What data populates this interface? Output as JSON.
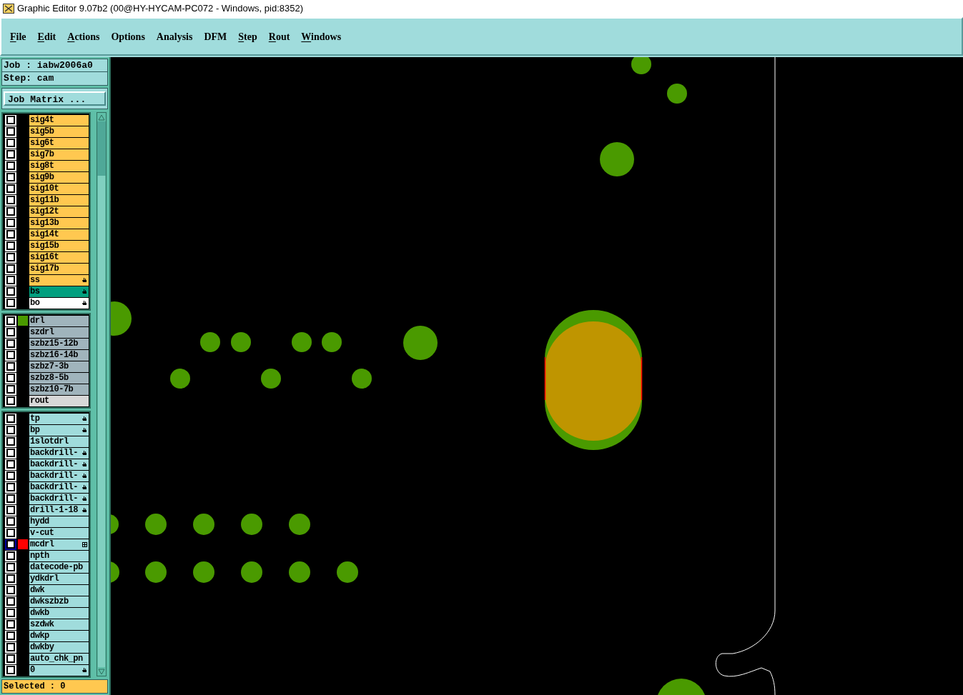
{
  "window": {
    "title": "Graphic Editor 9.07b2 (00@HY-HYCAM-PC072 - Windows, pid:8352)"
  },
  "menu": [
    {
      "label": "File",
      "mnemonic": true
    },
    {
      "label": "Edit",
      "mnemonic": true
    },
    {
      "label": "Actions",
      "mnemonic": true
    },
    {
      "label": "Options",
      "mnemonic": false
    },
    {
      "label": "Analysis",
      "mnemonic": false
    },
    {
      "label": "DFM",
      "mnemonic": false
    },
    {
      "label": "Step",
      "mnemonic": true
    },
    {
      "label": "Rout",
      "mnemonic": true
    },
    {
      "label": "Windows",
      "mnemonic": true
    }
  ],
  "job": "Job : iabw2006a0",
  "step": "Step: cam",
  "job_matrix_button": "Job Matrix ...",
  "layer_groups": [
    {
      "layers": [
        {
          "name": "sig4t",
          "kind": "board",
          "selected": false,
          "checked": false,
          "focused": false,
          "hand_icon": false,
          "grid_icon": false
        },
        {
          "name": "sig5b",
          "kind": "board",
          "selected": false,
          "checked": false,
          "focused": false,
          "hand_icon": false,
          "grid_icon": false
        },
        {
          "name": "sig6t",
          "kind": "board",
          "selected": false,
          "checked": false,
          "focused": false,
          "hand_icon": false,
          "grid_icon": false
        },
        {
          "name": "sig7b",
          "kind": "board",
          "selected": false,
          "checked": false,
          "focused": false,
          "hand_icon": false,
          "grid_icon": false
        },
        {
          "name": "sig8t",
          "kind": "board",
          "selected": false,
          "checked": false,
          "focused": false,
          "hand_icon": false,
          "grid_icon": false
        },
        {
          "name": "sig9b",
          "kind": "board",
          "selected": false,
          "checked": false,
          "focused": false,
          "hand_icon": false,
          "grid_icon": false
        },
        {
          "name": "sig10t",
          "kind": "board",
          "selected": false,
          "checked": false,
          "focused": false,
          "hand_icon": false,
          "grid_icon": false
        },
        {
          "name": "sig11b",
          "kind": "board",
          "selected": false,
          "checked": false,
          "focused": false,
          "hand_icon": false,
          "grid_icon": false
        },
        {
          "name": "sig12t",
          "kind": "board",
          "selected": false,
          "checked": false,
          "focused": false,
          "hand_icon": false,
          "grid_icon": false
        },
        {
          "name": "sig13b",
          "kind": "board",
          "selected": false,
          "checked": false,
          "focused": false,
          "hand_icon": false,
          "grid_icon": false
        },
        {
          "name": "sig14t",
          "kind": "board",
          "selected": false,
          "checked": false,
          "focused": false,
          "hand_icon": false,
          "grid_icon": false
        },
        {
          "name": "sig15b",
          "kind": "board",
          "selected": false,
          "checked": false,
          "focused": false,
          "hand_icon": false,
          "grid_icon": false
        },
        {
          "name": "sig16t",
          "kind": "board",
          "selected": false,
          "checked": false,
          "focused": false,
          "hand_icon": false,
          "grid_icon": false
        },
        {
          "name": "sig17b",
          "kind": "board",
          "selected": false,
          "checked": false,
          "focused": false,
          "hand_icon": false,
          "grid_icon": false
        },
        {
          "name": "ss",
          "kind": "board",
          "selected": false,
          "checked": false,
          "focused": false,
          "hand_icon": true,
          "grid_icon": false
        },
        {
          "name": "bs",
          "kind": "board",
          "selected": true,
          "checked": false,
          "focused": false,
          "hand_icon": true,
          "grid_icon": false
        },
        {
          "name": "bo",
          "kind": "outline",
          "selected": false,
          "checked": false,
          "focused": false,
          "hand_icon": true,
          "grid_icon": false
        }
      ]
    },
    {
      "layers": [
        {
          "name": "drl",
          "kind": "drill",
          "selected": false,
          "checked": false,
          "focused": false,
          "hand_icon": false,
          "grid_icon": false,
          "color": "#4a9a00"
        },
        {
          "name": "szdrl",
          "kind": "drill",
          "selected": false,
          "checked": false,
          "focused": false,
          "hand_icon": false,
          "grid_icon": false
        },
        {
          "name": "szbz15-12b",
          "kind": "drill",
          "selected": false,
          "checked": false,
          "focused": false,
          "hand_icon": false,
          "grid_icon": false
        },
        {
          "name": "szbz16-14b",
          "kind": "drill",
          "selected": false,
          "checked": false,
          "focused": false,
          "hand_icon": false,
          "grid_icon": false
        },
        {
          "name": "szbz7-3b",
          "kind": "drill",
          "selected": false,
          "checked": false,
          "focused": false,
          "hand_icon": false,
          "grid_icon": false
        },
        {
          "name": "szbz8-5b",
          "kind": "drill",
          "selected": false,
          "checked": false,
          "focused": false,
          "hand_icon": false,
          "grid_icon": false
        },
        {
          "name": "szbz10-7b",
          "kind": "drill",
          "selected": false,
          "checked": false,
          "focused": false,
          "hand_icon": false,
          "grid_icon": false
        },
        {
          "name": "rout",
          "kind": "rout",
          "selected": false,
          "checked": false,
          "focused": false,
          "hand_icon": false,
          "grid_icon": false
        }
      ]
    },
    {
      "layers": [
        {
          "name": "tp",
          "kind": "misc",
          "selected": false,
          "checked": false,
          "focused": false,
          "hand_icon": true,
          "grid_icon": false
        },
        {
          "name": "bp",
          "kind": "misc",
          "selected": false,
          "checked": false,
          "focused": false,
          "hand_icon": true,
          "grid_icon": false
        },
        {
          "name": "1slotdrl",
          "kind": "misc",
          "selected": false,
          "checked": false,
          "focused": false,
          "hand_icon": false,
          "grid_icon": false
        },
        {
          "name": "backdrill-",
          "kind": "misc",
          "selected": false,
          "checked": false,
          "focused": false,
          "hand_icon": true,
          "grid_icon": false
        },
        {
          "name": "backdrill-",
          "kind": "misc",
          "selected": false,
          "checked": false,
          "focused": false,
          "hand_icon": true,
          "grid_icon": false
        },
        {
          "name": "backdrill-",
          "kind": "misc",
          "selected": false,
          "checked": false,
          "focused": false,
          "hand_icon": true,
          "grid_icon": false
        },
        {
          "name": "backdrill-",
          "kind": "misc",
          "selected": false,
          "checked": false,
          "focused": false,
          "hand_icon": true,
          "grid_icon": false
        },
        {
          "name": "backdrill-",
          "kind": "misc",
          "selected": false,
          "checked": false,
          "focused": false,
          "hand_icon": true,
          "grid_icon": false
        },
        {
          "name": "drill-1-18",
          "kind": "misc",
          "selected": false,
          "checked": false,
          "focused": false,
          "hand_icon": true,
          "grid_icon": false
        },
        {
          "name": "hydd",
          "kind": "misc",
          "selected": false,
          "checked": false,
          "focused": false,
          "hand_icon": false,
          "grid_icon": false
        },
        {
          "name": "v-cut",
          "kind": "misc",
          "selected": false,
          "checked": false,
          "focused": false,
          "hand_icon": false,
          "grid_icon": false
        },
        {
          "name": "mcdrl",
          "kind": "misc",
          "selected": false,
          "checked": false,
          "focused": true,
          "hand_icon": false,
          "grid_icon": true,
          "color": "#ff0000"
        },
        {
          "name": "npth",
          "kind": "misc",
          "selected": false,
          "checked": false,
          "focused": false,
          "hand_icon": false,
          "grid_icon": false
        },
        {
          "name": "datecode-pb",
          "kind": "misc",
          "selected": false,
          "checked": false,
          "focused": false,
          "hand_icon": false,
          "grid_icon": false
        },
        {
          "name": "ydkdrl",
          "kind": "misc",
          "selected": false,
          "checked": false,
          "focused": false,
          "hand_icon": false,
          "grid_icon": false
        },
        {
          "name": "dwk",
          "kind": "misc",
          "selected": false,
          "checked": false,
          "focused": false,
          "hand_icon": false,
          "grid_icon": false
        },
        {
          "name": "dwkszbzb",
          "kind": "misc",
          "selected": false,
          "checked": false,
          "focused": false,
          "hand_icon": false,
          "grid_icon": false
        },
        {
          "name": "dwkb",
          "kind": "misc",
          "selected": false,
          "checked": false,
          "focused": false,
          "hand_icon": false,
          "grid_icon": false
        },
        {
          "name": "szdwk",
          "kind": "misc",
          "selected": false,
          "checked": false,
          "focused": false,
          "hand_icon": false,
          "grid_icon": false
        },
        {
          "name": "dwkp",
          "kind": "misc",
          "selected": false,
          "checked": false,
          "focused": false,
          "hand_icon": false,
          "grid_icon": false
        },
        {
          "name": "dwkby",
          "kind": "misc",
          "selected": false,
          "checked": false,
          "focused": false,
          "hand_icon": false,
          "grid_icon": false
        },
        {
          "name": "auto_chk_pn",
          "kind": "misc",
          "selected": false,
          "checked": false,
          "focused": false,
          "hand_icon": false,
          "grid_icon": false
        },
        {
          "name": "0",
          "kind": "misc",
          "selected": false,
          "checked": false,
          "focused": false,
          "hand_icon": true,
          "grid_icon": false
        }
      ]
    }
  ],
  "status": "Selected : 0"
}
